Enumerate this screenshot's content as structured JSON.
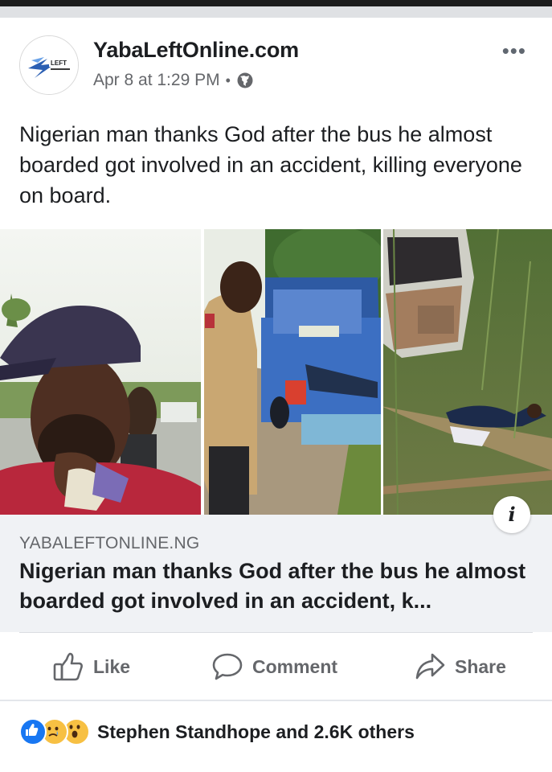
{
  "post": {
    "page_name": "YabaLeftOnline.com",
    "date": "Apr 8 at 1:29 PM",
    "separator": "•",
    "more": "•••",
    "text": "Nigerian man thanks God after the bus he almost boarded got involved in an accident, killing everyone on board.",
    "avatar": {
      "logo_text": "YABA LEFT",
      "icon": "yabaleft-logo"
    },
    "privacy_icon": "globe-icon"
  },
  "link_preview": {
    "domain": "YABALEFTONLINE.NG",
    "title": "Nigerian man thanks God after the bus he almost boarded got involved in an accident, k...",
    "info": "i"
  },
  "actions": {
    "like": "Like",
    "comment": "Comment",
    "share": "Share"
  },
  "reactions": {
    "types": [
      "like",
      "sad",
      "wow"
    ],
    "summary": "Stephen Standhope and 2.6K others"
  },
  "colors": {
    "facebook_blue": "#1877f2",
    "text_primary": "#1c1e21",
    "text_secondary": "#65676b",
    "preview_bg": "#f0f2f5"
  }
}
